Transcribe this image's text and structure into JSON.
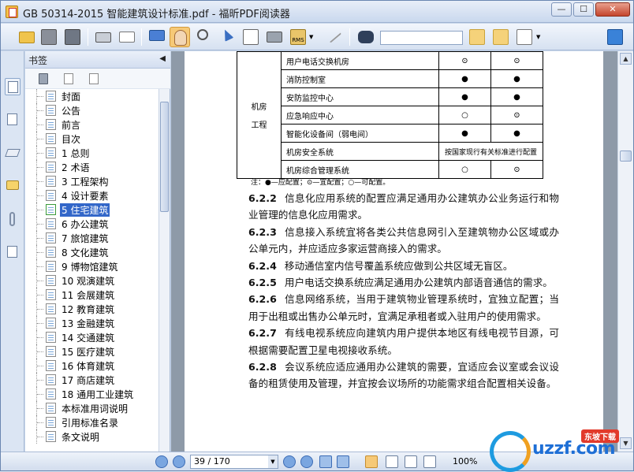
{
  "window": {
    "title": "GB 50314-2015 智能建筑设计标准.pdf - 福昕PDF阅读器",
    "minimize_icon": "minimize-icon",
    "maximize_icon": "maximize-icon",
    "close_icon": "close-icon"
  },
  "toolbar": {
    "search_placeholder": "",
    "icons": [
      "open-folder-icon",
      "save-icon",
      "save-all-icon",
      "print-icon",
      "email-icon",
      "fullscreen-icon",
      "hand-tool-icon",
      "zoom-tool-icon",
      "select-arrow-icon",
      "text-select-icon",
      "snapshot-icon",
      "rms-icon",
      "sign-icon",
      "find-binoculars-icon",
      "find-prev-icon",
      "find-next-icon",
      "find-options-icon",
      "expand-icon"
    ],
    "rms_label": "RMS"
  },
  "sidebar": {
    "title": "书签",
    "collapse": "◀",
    "strip_icons": [
      "pages-icon",
      "thumbnails-icon",
      "layers-icon",
      "comments-icon",
      "attachments-icon",
      "signatures-icon"
    ],
    "tool_icons": [
      "delete-bookmark-icon",
      "add-bookmark-icon",
      "add-child-bookmark-icon"
    ],
    "bookmarks": [
      {
        "label": "封面"
      },
      {
        "label": "公告"
      },
      {
        "label": "前言"
      },
      {
        "label": "目次"
      },
      {
        "label": "1 总则"
      },
      {
        "label": "2 术语"
      },
      {
        "label": "3 工程架构"
      },
      {
        "label": "4 设计要素"
      },
      {
        "label": "5 住宅建筑",
        "selected": true
      },
      {
        "label": "6 办公建筑"
      },
      {
        "label": "7 旅馆建筑"
      },
      {
        "label": "8 文化建筑"
      },
      {
        "label": "9 博物馆建筑"
      },
      {
        "label": "10 观演建筑"
      },
      {
        "label": "11 会展建筑"
      },
      {
        "label": "12 教育建筑"
      },
      {
        "label": "13 金融建筑"
      },
      {
        "label": "14 交通建筑"
      },
      {
        "label": "15 医疗建筑"
      },
      {
        "label": "16 体育建筑"
      },
      {
        "label": "17 商店建筑"
      },
      {
        "label": "18 通用工业建筑"
      },
      {
        "label": "本标准用词说明"
      },
      {
        "label": "引用标准名录"
      },
      {
        "label": "条文说明"
      }
    ]
  },
  "document": {
    "table": {
      "category": "机房工程",
      "category_line1": "机房",
      "category_line2": "工程",
      "rows": [
        {
          "name": "用户电话交换机房",
          "c1": "⊙",
          "c2": "⊙"
        },
        {
          "name": "消防控制室",
          "c1": "●",
          "c2": "●"
        },
        {
          "name": "安防监控中心",
          "c1": "●",
          "c2": "●"
        },
        {
          "name": "应急响应中心",
          "c1": "○",
          "c2": "⊙"
        },
        {
          "name": "智能化设备间（弱电间）",
          "c1": "●",
          "c2": "●"
        },
        {
          "name": "机房安全系统",
          "c_wide": "按国家现行有关标准进行配置"
        },
        {
          "name": "机房综合管理系统",
          "c1": "○",
          "c2": "⊙"
        }
      ]
    },
    "note": "注：●—应配置；⊙—宜配置；○—可配置。",
    "clauses": [
      {
        "num": "6.2.2",
        "text": "信息化应用系统的配置应满足通用办公建筑办公业务运行和物业管理的信息化应用需求。"
      },
      {
        "num": "6.2.3",
        "text": "信息接入系统宜将各类公共信息网引入至建筑物办公区域或办公单元内，并应适应多家运营商接入的需求。"
      },
      {
        "num": "6.2.4",
        "text": "移动通信室内信号覆盖系统应做到公共区域无盲区。"
      },
      {
        "num": "6.2.5",
        "text": "用户电话交换系统应满足通用办公建筑内部语音通信的需求。"
      },
      {
        "num": "6.2.6",
        "text": "信息网络系统，当用于建筑物业管理系统时，宜独立配置；当用于出租或出售办公单元时，宜满足承租者或入驻用户的使用需求。"
      },
      {
        "num": "6.2.7",
        "text": "有线电视系统应向建筑内用户提供本地区有线电视节目源，可根据需要配置卫星电视接收系统。"
      },
      {
        "num": "6.2.8",
        "text": "会议系统应适应通用办公建筑的需要，宜适应会议室或会议设备的租赁使用及管理，并宜按会议场所的功能需求组合配置相关设备。"
      }
    ]
  },
  "statusbar": {
    "page_value": "39 / 170",
    "zoom": "100%",
    "nav_icons": [
      "first-page-icon",
      "prev-page-icon",
      "next-page-icon",
      "last-page-icon",
      "back-icon",
      "forward-icon"
    ],
    "view_icons": [
      "single-page-icon",
      "continuous-icon",
      "facing-icon",
      "continuous-facing-icon"
    ]
  },
  "watermark": {
    "text": "uzzf.com",
    "tag": "东坡下载"
  }
}
